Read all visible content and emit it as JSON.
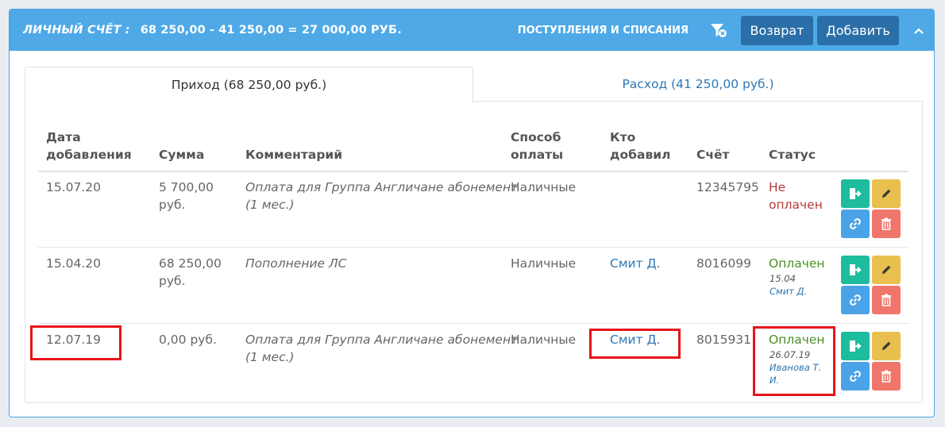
{
  "header": {
    "title_label": "ЛИЧНЫЙ СЧЁТ :",
    "title_value": "68 250,00 - 41 250,00 = 27 000,00 РУБ.",
    "link": "ПОСТУПЛЕНИЯ И СПИСАНИЯ",
    "return_button": "Возврат",
    "add_button": "Добавить",
    "filter_icon": "filter-icon",
    "collapse_icon": "chevron-up-icon"
  },
  "tabs": [
    {
      "label": "Приход (68 250,00 руб.)",
      "active": true
    },
    {
      "label": "Расход (41 250,00 руб.)",
      "active": false
    }
  ],
  "table": {
    "columns": {
      "date": [
        "Дата",
        "добавления"
      ],
      "sum": "Сумма",
      "comment": "Комментарий",
      "payment": [
        "Способ",
        "оплаты"
      ],
      "who": [
        "Кто",
        "добавил"
      ],
      "account": "Счёт",
      "status": "Статус"
    },
    "rows": [
      {
        "date": "15.07.20",
        "sum": [
          "5 700,00",
          "руб."
        ],
        "comment": [
          "Оплата для Группа Англичане абонемент",
          "(1 мес.)"
        ],
        "payment": "Наличные",
        "who": "",
        "account": "12345795",
        "status": [
          "Не",
          "оплачен"
        ],
        "status_date": "",
        "status_by": []
      },
      {
        "date": "15.04.20",
        "sum": [
          "68 250,00",
          "руб."
        ],
        "comment": [
          "Пополнение ЛС"
        ],
        "payment": "Наличные",
        "who": "Смит Д.",
        "account": "8016099",
        "status": [
          "Оплачен"
        ],
        "status_date": "15.04",
        "status_by": [
          "Смит Д."
        ]
      },
      {
        "date": "12.07.19",
        "sum": [
          "0,00 руб."
        ],
        "comment": [
          "Оплата для Группа Англичане абонемент",
          "(1 мес.)"
        ],
        "payment": "Наличные",
        "who": "Смит Д.",
        "account": "8015931",
        "status": [
          "Оплачен"
        ],
        "status_date": "26.07.19",
        "status_by": [
          "Иванова Т.",
          "И."
        ]
      }
    ],
    "row_actions": [
      "export-icon",
      "pencil-icon",
      "link-icon",
      "trash-icon"
    ]
  },
  "colors": {
    "header_bg": "#4ea9e6",
    "header_button": "#2b6fa8",
    "link": "#2e77b4",
    "unpaid": "#b73a3a",
    "paid": "#4c8f26",
    "highlight": "#e8141a"
  }
}
